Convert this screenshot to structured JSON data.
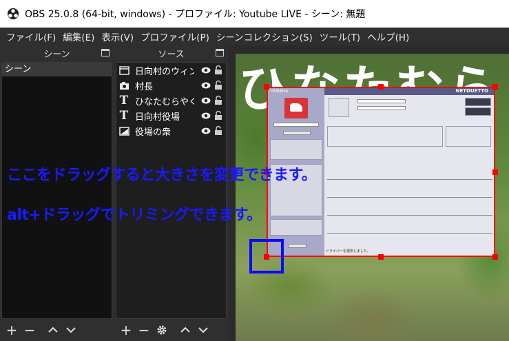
{
  "window": {
    "title": "OBS 25.0.8 (64-bit, windows) - プロファイル: Youtube LIVE - シーン: 無題"
  },
  "menu": [
    "ファイル(F)",
    "編集(E)",
    "表示(V)",
    "プロファイル(P)",
    "シーンコレクション(S)",
    "ツール(T)",
    "ヘルプ(H)"
  ],
  "scenes": {
    "title": "シーン",
    "items": [
      "シーン"
    ]
  },
  "sources": {
    "title": "ソース",
    "items": [
      {
        "name": "日向村のウィン",
        "type": "window-capture-icon"
      },
      {
        "name": "村長",
        "type": "camera-icon"
      },
      {
        "name": "ひなたむらやくば",
        "type": "text-icon"
      },
      {
        "name": "日向村役場",
        "type": "text-icon"
      },
      {
        "name": "役場の衆",
        "type": "image-icon"
      }
    ]
  },
  "toolbar": {
    "add": "+",
    "remove": "−",
    "up": "︿",
    "down": "﹀"
  },
  "preview": {
    "banner_text": "ひなたむら",
    "netduetto": {
      "brand": "YAMAHA",
      "logo": "NETDUETTO",
      "status_text": "ドライバーを選択しました。"
    }
  },
  "annotations": {
    "line1": "ここをドラッグすると大きさを変更できます。",
    "line2": "alt+ドラッグでトリミングできます。"
  },
  "colors": {
    "annotation": "#1a1aff",
    "selection": "#ff0000"
  }
}
